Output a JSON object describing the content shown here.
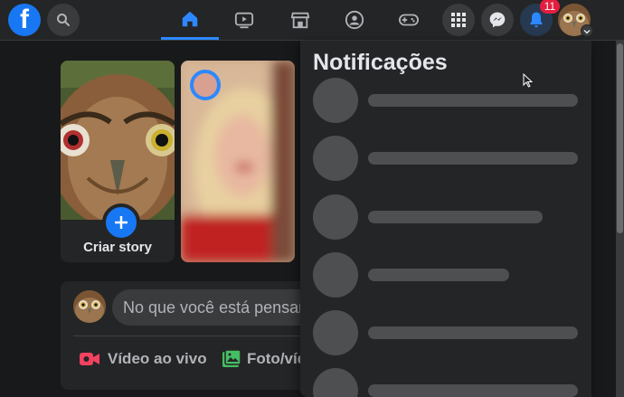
{
  "topbar": {
    "logo_letter": "f",
    "nav_tabs": [
      {
        "name": "home",
        "icon": "home-icon",
        "active": true
      },
      {
        "name": "watch",
        "icon": "video-icon",
        "active": false
      },
      {
        "name": "marketplace",
        "icon": "store-icon",
        "active": false
      },
      {
        "name": "groups",
        "icon": "groups-icon",
        "active": false
      },
      {
        "name": "gaming",
        "icon": "gamepad-icon",
        "active": false
      }
    ],
    "notification_count": "11"
  },
  "stories": {
    "create_label": "Criar story"
  },
  "composer": {
    "placeholder": "No que você está pensando?",
    "actions": [
      {
        "label": "Vídeo ao vivo",
        "icon": "live-video-icon",
        "color": "#f3425f"
      },
      {
        "label": "Foto/vídeo",
        "icon": "photo-icon",
        "color": "#45bd62"
      }
    ]
  },
  "notifications": {
    "title": "Notificações",
    "loading_items": 6
  },
  "colors": {
    "accent": "#1877f2",
    "active_tab": "#2d88ff",
    "badge": "#e41e3f",
    "background": "#18191a",
    "surface": "#242526"
  }
}
